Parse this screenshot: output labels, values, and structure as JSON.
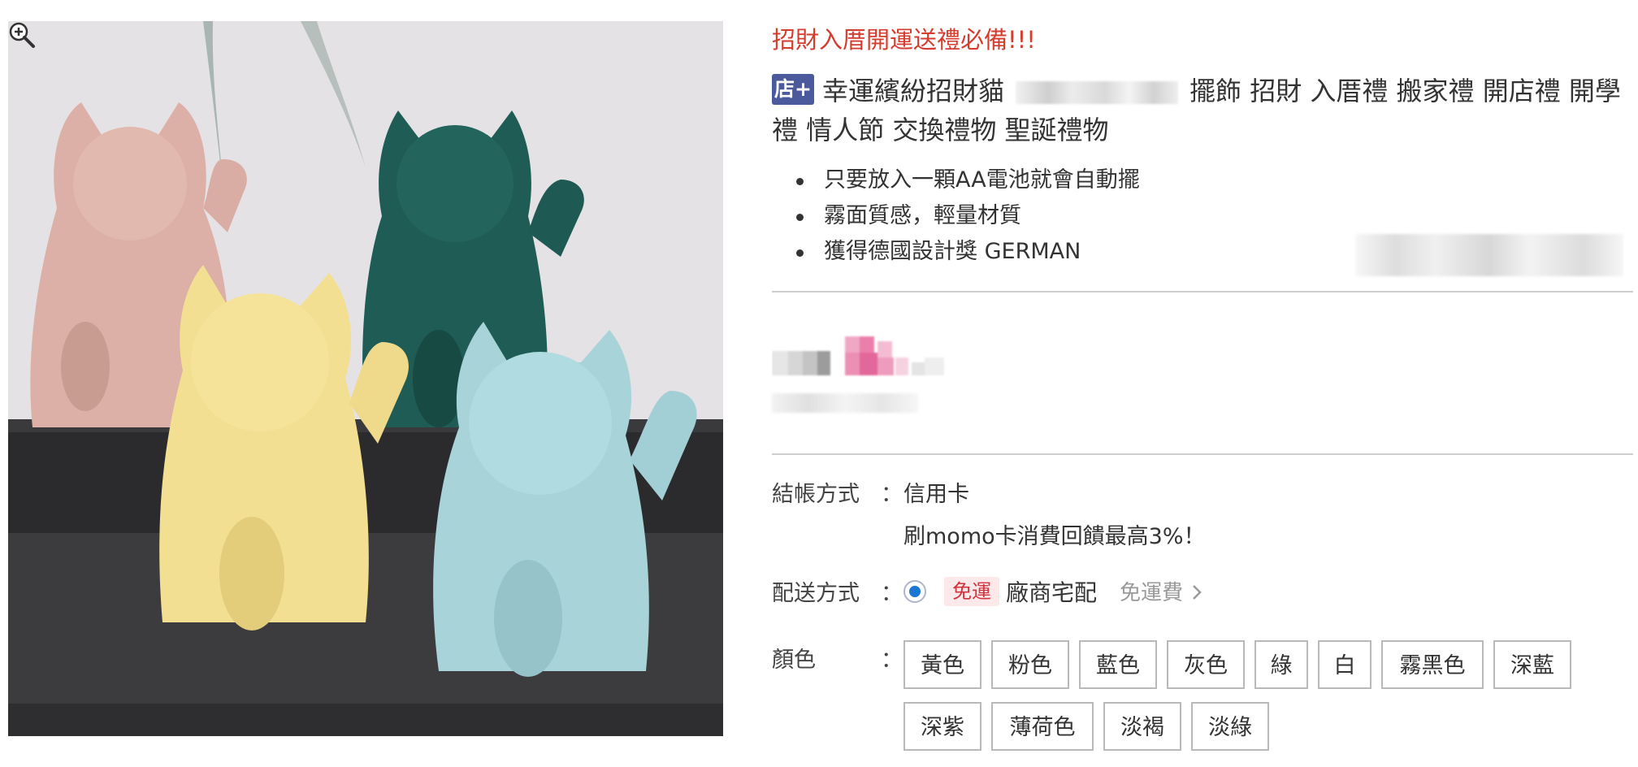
{
  "product": {
    "slogan": "招財入厝開運送禮必備!!!",
    "store_badge": "店+",
    "title_part1": "幸運繽紛招財貓",
    "title_part2": "擺飾 招財 入厝禮 搬家禮 開店禮 開學禮 情人節 交換禮物 聖誕禮物",
    "bullets": [
      "只要放入一顆AA電池就會自動擺",
      "霧面質感，輕量材質",
      "獲得德國設計獎 GERMAN"
    ]
  },
  "checkout": {
    "payment_label": "結帳方式",
    "colon": "：",
    "payment_value": "信用卡",
    "payment_promo": "刷momo卡消費回饋最高3%！",
    "shipping_label": "配送方式",
    "free_badge": "免運",
    "shipping_method": "廠商宅配",
    "shipping_fee_link": "免運費",
    "color_label": "顏色",
    "colors": [
      "黃色",
      "粉色",
      "藍色",
      "灰色",
      "綠",
      "白",
      "霧黑色",
      "深藍",
      "深紫",
      "薄荷色",
      "淡褐",
      "淡綠"
    ]
  },
  "icons": {
    "zoom": "zoom-in-icon",
    "chevron": "chevron-right-icon"
  },
  "theme": {
    "accent_red": "#d53c2e",
    "badge_blue": "#4b5a9c",
    "radio_blue": "#1976d2"
  }
}
